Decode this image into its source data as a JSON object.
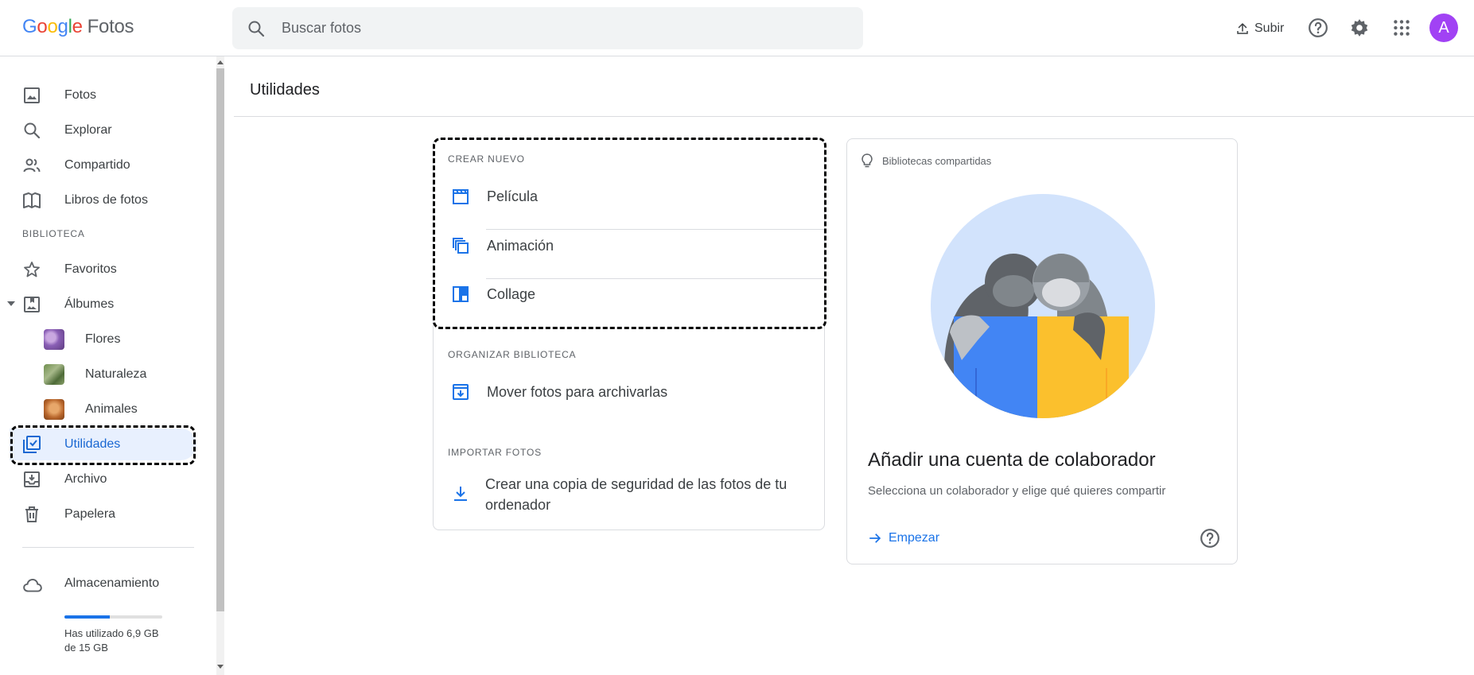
{
  "header": {
    "logo_letters": [
      "G",
      "o",
      "o",
      "g",
      "l",
      "e"
    ],
    "logo_product": "Fotos",
    "search_placeholder": "Buscar fotos",
    "upload_label": "Subir",
    "avatar_letter": "A"
  },
  "sidebar": {
    "items": [
      {
        "label": "Fotos",
        "icon": "photo-icon"
      },
      {
        "label": "Explorar",
        "icon": "search-icon"
      },
      {
        "label": "Compartido",
        "icon": "people-icon"
      },
      {
        "label": "Libros de fotos",
        "icon": "book-icon"
      }
    ],
    "library_section": "BIBLIOTECA",
    "library_items": [
      {
        "label": "Favoritos",
        "icon": "star-icon"
      },
      {
        "label": "Álbumes",
        "icon": "album-icon"
      },
      {
        "label": "Flores",
        "icon": "album-thumbnail"
      },
      {
        "label": "Naturaleza",
        "icon": "album-thumbnail"
      },
      {
        "label": "Animales",
        "icon": "album-thumbnail"
      },
      {
        "label": "Utilidades",
        "icon": "utilities-icon",
        "active": true
      },
      {
        "label": "Archivo",
        "icon": "archive-icon"
      },
      {
        "label": "Papelera",
        "icon": "trash-icon"
      }
    ],
    "storage": {
      "title": "Almacenamiento",
      "usage_text": "Has utilizado 6,9 GB de 15 GB",
      "used_fraction": 0.46
    }
  },
  "main": {
    "title": "Utilidades",
    "create_section": "CREAR NUEVO",
    "create_items": [
      {
        "label": "Película",
        "icon": "movie-icon"
      },
      {
        "label": "Animación",
        "icon": "animation-icon"
      },
      {
        "label": "Collage",
        "icon": "collage-icon"
      }
    ],
    "organize_section": "ORGANIZAR BIBLIOTECA",
    "organize_items": [
      {
        "label": "Mover fotos para archivarlas",
        "icon": "archive-move-icon"
      }
    ],
    "import_section": "IMPORTAR FOTOS",
    "import_items": [
      {
        "label": "Crear una copia de seguridad de las fotos de tu ordenador",
        "icon": "download-icon"
      }
    ],
    "partner_card": {
      "hint": "Bibliotecas compartidas",
      "title": "Añadir una cuenta de colaborador",
      "description": "Selecciona un colaborador y elige qué quieres compartir",
      "link_label": "Empezar"
    }
  },
  "colors": {
    "accent": "#1a73e8",
    "active_bg": "#e8f0fe",
    "avatar_bg": "#a142f4",
    "illus_bg": "#d2e3fc",
    "illus_blue": "#4285f4",
    "illus_yellow": "#fbc02d"
  }
}
